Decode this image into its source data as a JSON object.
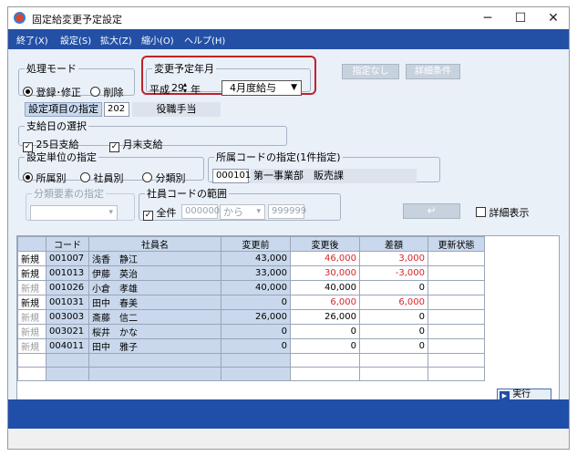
{
  "window": {
    "title": "固定給変更予定設定",
    "minimize": "─",
    "maximize": "☐",
    "close": "✕"
  },
  "menu": [
    "終了(X)",
    "設定(S)",
    "拡大(Z)",
    "縮小(O)",
    "ヘルプ(H)"
  ],
  "process_mode": {
    "legend": "処理モード",
    "options": [
      "登録･修正",
      "削除"
    ],
    "selected": 0
  },
  "change_date": {
    "legend": "変更予定年月",
    "era": "平成",
    "year": "29",
    "year_unit": "年",
    "month": "4月度給与"
  },
  "buttons": {
    "none": "指定なし",
    "detail_cond": "詳細条件",
    "enter": "↵",
    "run": "実行"
  },
  "item": {
    "label": "設定項目の指定",
    "code": "202",
    "name": "役職手当"
  },
  "pay_day": {
    "legend": "支給日の選択",
    "opt1": "25日支給",
    "opt2": "月末支給"
  },
  "unit": {
    "legend": "設定単位の指定",
    "options": [
      "所属別",
      "社員別",
      "分類別"
    ],
    "selected": 0
  },
  "dept": {
    "legend": "所属コードの指定(1件指定)",
    "code": "000101",
    "name": "第一事業部　販売課"
  },
  "class_elem": {
    "legend": "分類要素の指定"
  },
  "emp_range": {
    "legend": "社員コードの範囲",
    "all": "全件",
    "from": "000000",
    "kara": "から",
    "to": "999999"
  },
  "detail_check": "詳細表示",
  "table": {
    "headers": [
      "",
      "コード",
      "社員名",
      "変更前",
      "変更後",
      "差額",
      "更新状態"
    ],
    "rows": [
      {
        "kubun": "新規",
        "code": "001007",
        "name": "浅香　静江",
        "before": "43,000",
        "after": "46,000",
        "diff": "3,000",
        "state": "",
        "dim": false,
        "red": true
      },
      {
        "kubun": "新規",
        "code": "001013",
        "name": "伊藤　英治",
        "before": "33,000",
        "after": "30,000",
        "diff": "-3,000",
        "state": "",
        "dim": false,
        "red": true
      },
      {
        "kubun": "新規",
        "code": "001026",
        "name": "小倉　孝雄",
        "before": "40,000",
        "after": "40,000",
        "diff": "0",
        "state": "",
        "dim": true,
        "red": false
      },
      {
        "kubun": "新規",
        "code": "001031",
        "name": "田中　春美",
        "before": "0",
        "after": "6,000",
        "diff": "6,000",
        "state": "",
        "dim": false,
        "red": true
      },
      {
        "kubun": "新規",
        "code": "003003",
        "name": "斎藤　信二",
        "before": "26,000",
        "after": "26,000",
        "diff": "0",
        "state": "",
        "dim": true,
        "red": false
      },
      {
        "kubun": "新規",
        "code": "003021",
        "name": "桜井　かな",
        "before": "0",
        "after": "0",
        "diff": "0",
        "state": "",
        "dim": true,
        "red": false
      },
      {
        "kubun": "新規",
        "code": "004011",
        "name": "田中　雅子",
        "before": "0",
        "after": "0",
        "diff": "0",
        "state": "",
        "dim": true,
        "red": false
      }
    ]
  },
  "colors": {
    "menubar": "#2350a5",
    "highlight": "#c0222b",
    "red_text": "#d6262b"
  }
}
